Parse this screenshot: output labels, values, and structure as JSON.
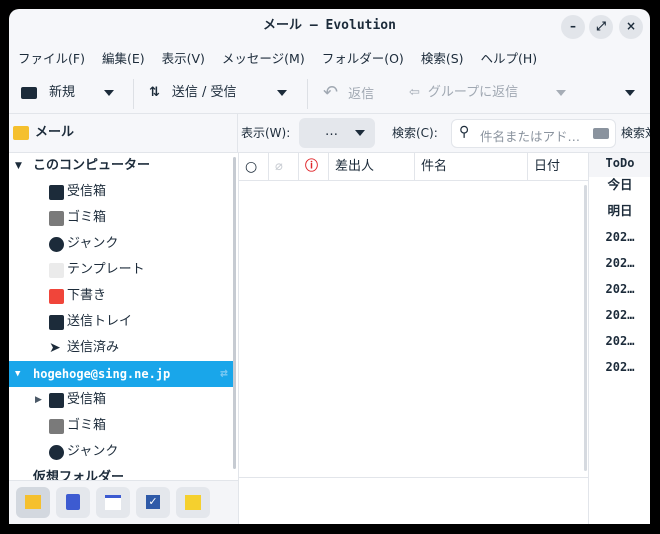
{
  "window": {
    "title": "メール — Evolution",
    "minimize": "–",
    "maximize": "⤢",
    "close": "×"
  },
  "menu": [
    "ファイル(F)",
    "編集(E)",
    "表示(V)",
    "メッセージ(M)",
    "フォルダー(O)",
    "検索(S)",
    "ヘルプ(H)"
  ],
  "toolbar": {
    "new": "新規",
    "send_receive": "送信 / 受信",
    "reply": "返信",
    "reply_group": "グループに返信"
  },
  "header": {
    "section": "メール",
    "show_label": "表示(W):",
    "show_value": "…",
    "search_label": "検索(C):",
    "search_placeholder": "件名またはアド…",
    "search_scope": "検索対象"
  },
  "sidebar": {
    "local": {
      "label": "このコンピューター",
      "folders": [
        "受信箱",
        "ゴミ箱",
        "ジャンク",
        "テンプレート",
        "下書き",
        "送信トレイ",
        "送信済み"
      ]
    },
    "account": {
      "label": "hogehoge@sing.ne.jp",
      "folders": [
        "受信箱",
        "ゴミ箱",
        "ジャンク"
      ]
    },
    "virtual": "仮想フォルダー"
  },
  "columns": [
    "差出人",
    "件名",
    "日付"
  ],
  "todo": {
    "title": "ToDo",
    "items": [
      "今日",
      "明日",
      "202…",
      "202…",
      "202…",
      "202…",
      "202…",
      "202…"
    ]
  },
  "colors": {
    "selection": "#19a6ea",
    "accent": "#1c2b3a",
    "draft": "#f0453a",
    "error": "#e0262b"
  }
}
